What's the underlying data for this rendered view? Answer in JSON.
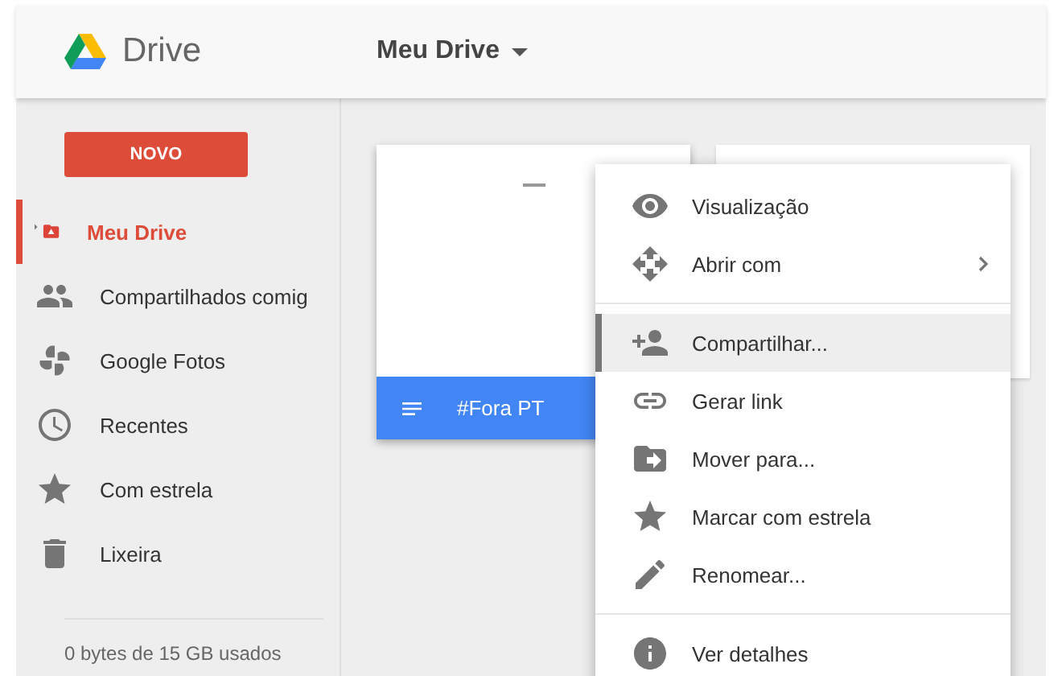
{
  "header": {
    "logo_text": "Drive",
    "location": "Meu Drive"
  },
  "sidebar": {
    "new_button": "NOVO",
    "items": [
      {
        "kind": "drive",
        "label": "Meu Drive",
        "selected": true
      },
      {
        "kind": "shared",
        "label": "Compartilhados comig",
        "selected": false
      },
      {
        "kind": "photos",
        "label": "Google Fotos",
        "selected": false
      },
      {
        "kind": "recent",
        "label": "Recentes",
        "selected": false
      },
      {
        "kind": "starred",
        "label": "Com estrela",
        "selected": false
      },
      {
        "kind": "trash",
        "label": "Lixeira",
        "selected": false
      }
    ],
    "storage": "0 bytes de 15 GB usados"
  },
  "files": [
    {
      "name": "#Fora PT",
      "selected": true
    },
    {
      "selected": false
    }
  ],
  "context_menu": {
    "groups": [
      [
        {
          "kind": "preview",
          "label": "Visualização",
          "highlighted": false,
          "submenu": false
        },
        {
          "kind": "open",
          "label": "Abrir com",
          "highlighted": false,
          "submenu": true
        }
      ],
      [
        {
          "kind": "share",
          "label": "Compartilhar...",
          "highlighted": true,
          "submenu": false
        },
        {
          "kind": "link",
          "label": "Gerar link",
          "highlighted": false,
          "submenu": false
        },
        {
          "kind": "move",
          "label": "Mover para...",
          "highlighted": false,
          "submenu": false
        },
        {
          "kind": "star",
          "label": "Marcar com estrela",
          "highlighted": false,
          "submenu": false
        },
        {
          "kind": "rename",
          "label": "Renomear...",
          "highlighted": false,
          "submenu": false
        }
      ],
      [
        {
          "kind": "info",
          "label": "Ver detalhes",
          "highlighted": false,
          "submenu": false
        }
      ]
    ]
  }
}
